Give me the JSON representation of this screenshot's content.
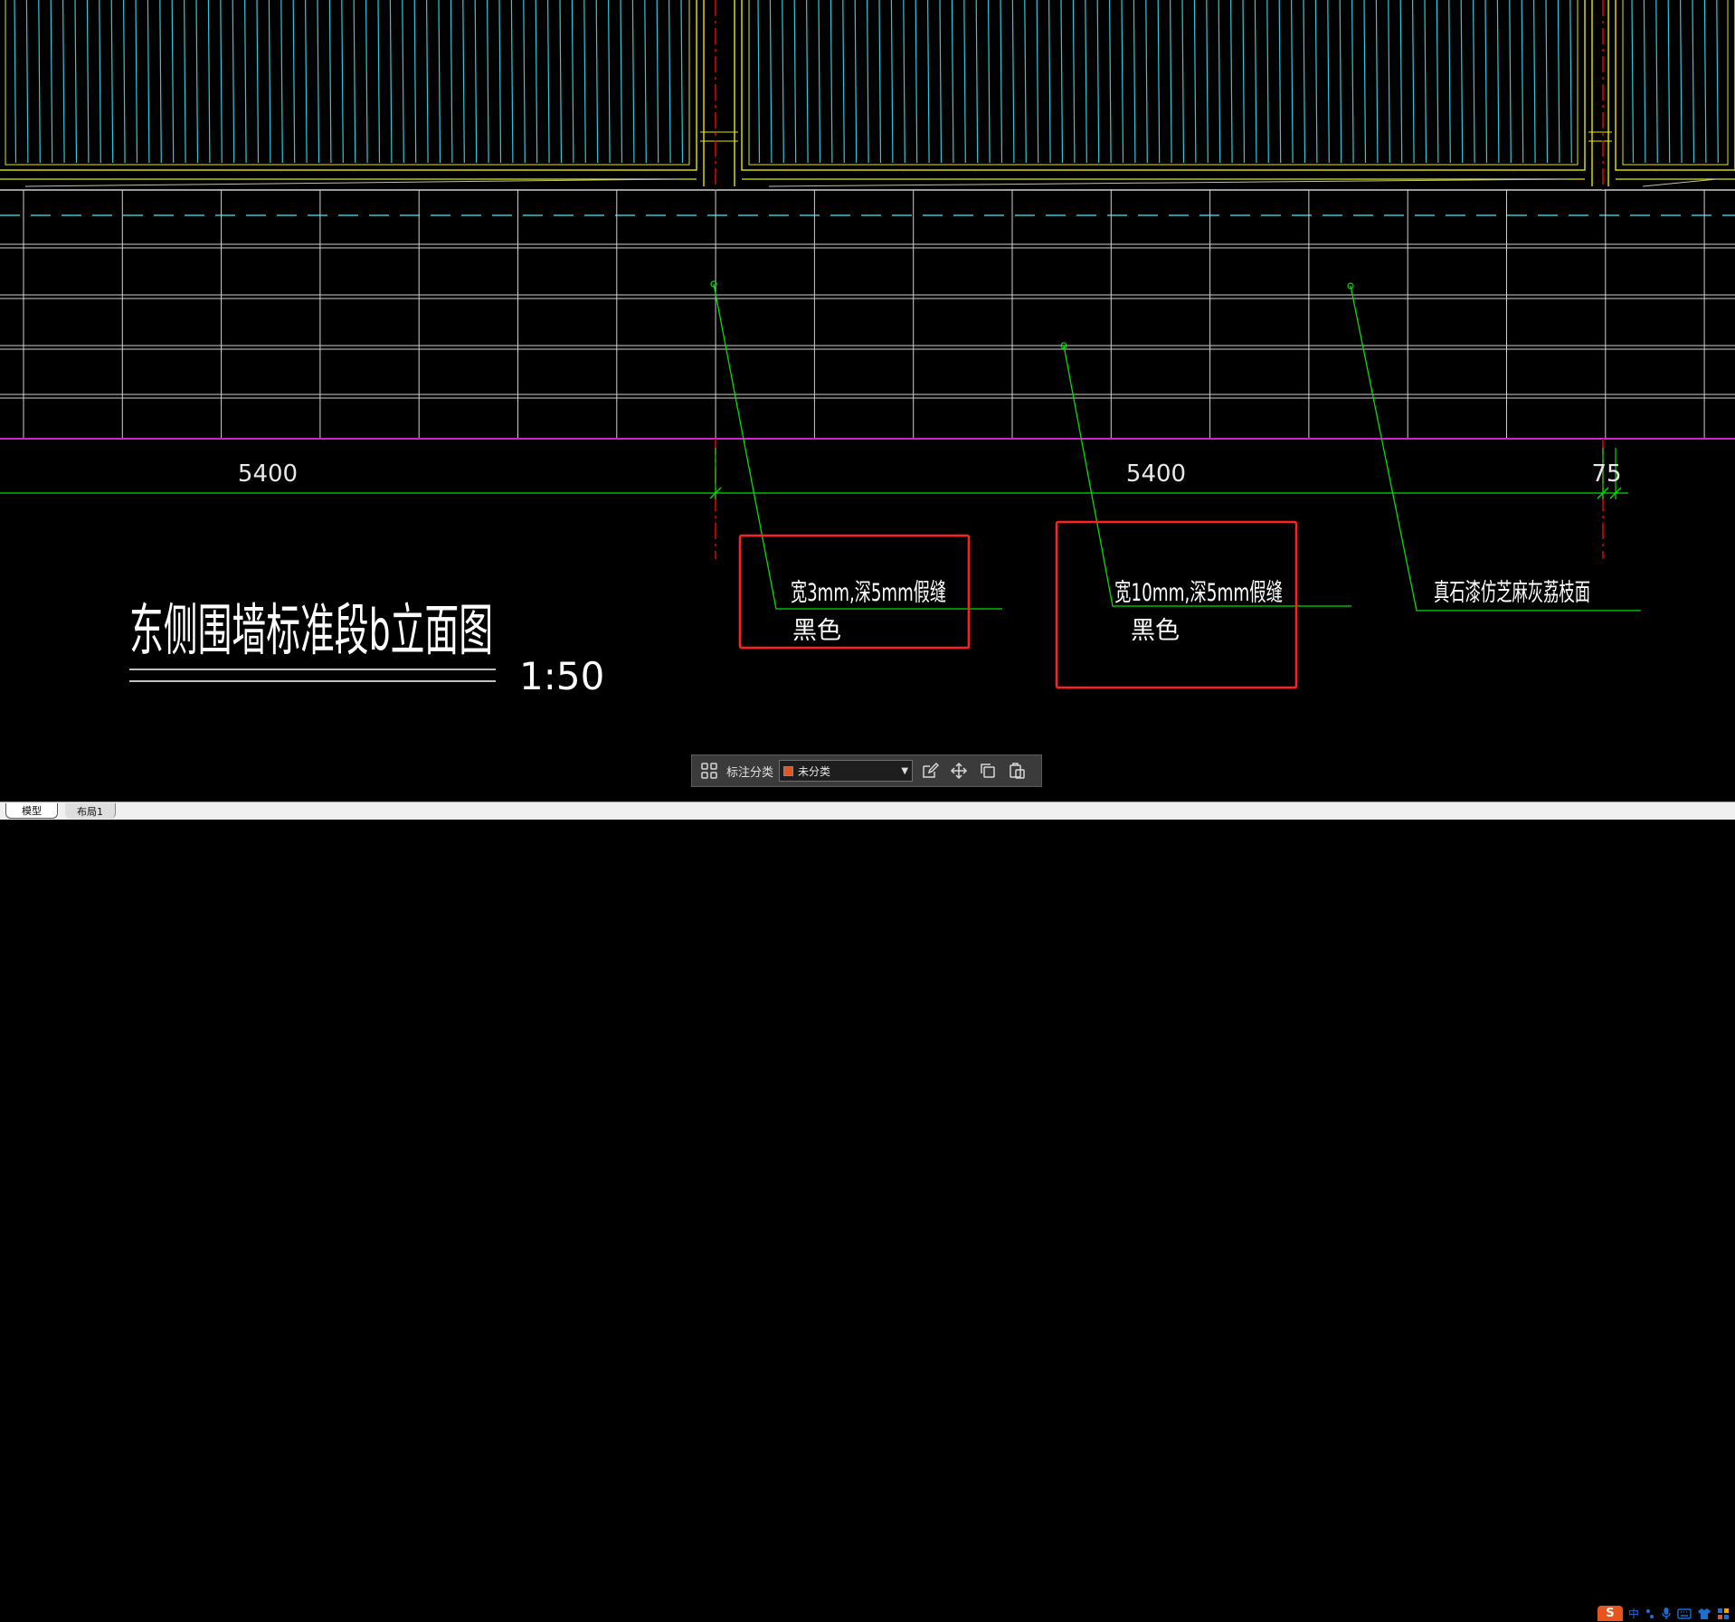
{
  "drawing": {
    "title": "东侧围墙标准段b立面图",
    "scale": "1:50",
    "dimensions": [
      "5400",
      "5400",
      "75"
    ],
    "annotations": [
      {
        "line1": "宽3mm,深5mm假缝",
        "line2": "黑色"
      },
      {
        "line1": "宽10mm,深5mm假缝",
        "line2": "黑色"
      },
      {
        "line1": "真石漆仿芝麻灰荔枝面",
        "line2": ""
      }
    ],
    "colors": {
      "background": "#000000",
      "frame": "#e6e600",
      "bars": "#30c8d8",
      "grid": "#d0d0d0",
      "baseline": "#d020d0",
      "leader": "#00e000",
      "axis": "#e00000",
      "highlight": "#ff2020"
    }
  },
  "toolbar": {
    "grid_icon": "grid-icon",
    "category_label": "标注分类",
    "category_value": "未分类",
    "category_color": "#e8541e",
    "tools": [
      "edit-icon",
      "move-icon",
      "copy-icon",
      "paste-icon"
    ]
  },
  "tabs": [
    {
      "label": "模型",
      "active": true
    },
    {
      "label": "布局1",
      "active": false
    }
  ],
  "tray": {
    "ime_logo": "S",
    "ime_lang": "中",
    "items": [
      "punctuation-icon",
      "microphone-icon",
      "keyboard-icon",
      "shirt-icon",
      "tools-icon"
    ]
  }
}
